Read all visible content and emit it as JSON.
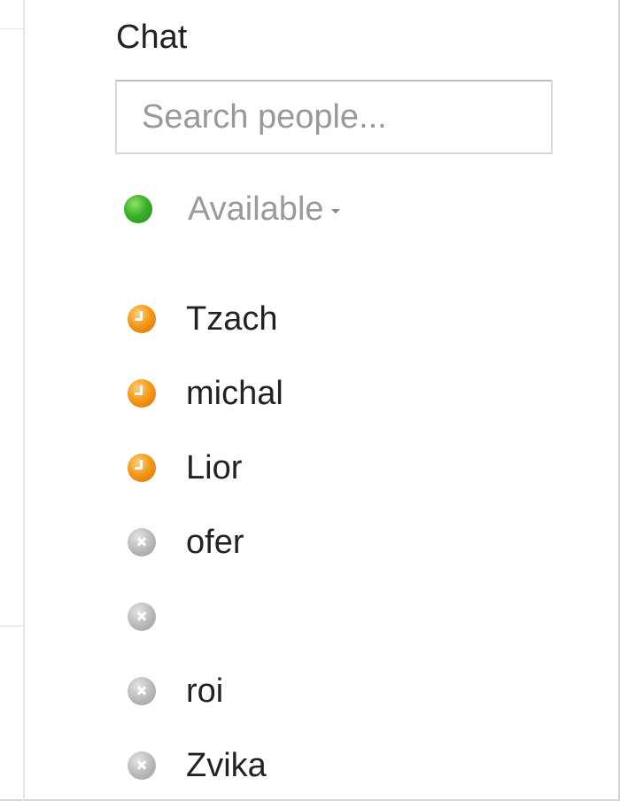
{
  "chat": {
    "title": "Chat",
    "search": {
      "placeholder": "Search people...",
      "value": ""
    },
    "status": {
      "label": "Available",
      "color": "#3cb12a",
      "icon": "status-available-icon",
      "dropdown_icon": "caret-down-icon"
    },
    "contacts": [
      {
        "name": "Tzach",
        "status": "idle",
        "icon": "idle-clock-icon"
      },
      {
        "name": "michal",
        "status": "idle",
        "icon": "idle-clock-icon"
      },
      {
        "name": "Lior",
        "status": "idle",
        "icon": "idle-clock-icon"
      },
      {
        "name": "ofer",
        "status": "offline",
        "icon": "offline-x-icon"
      },
      {
        "name": "",
        "status": "offline",
        "icon": "offline-x-icon"
      },
      {
        "name": "roi",
        "status": "offline",
        "icon": "offline-x-icon"
      },
      {
        "name": "Zvika",
        "status": "offline",
        "icon": "offline-x-icon"
      }
    ],
    "colors": {
      "idle": "#f59a1a",
      "offline": "#b8b8b8",
      "available": "#3cb12a"
    }
  }
}
